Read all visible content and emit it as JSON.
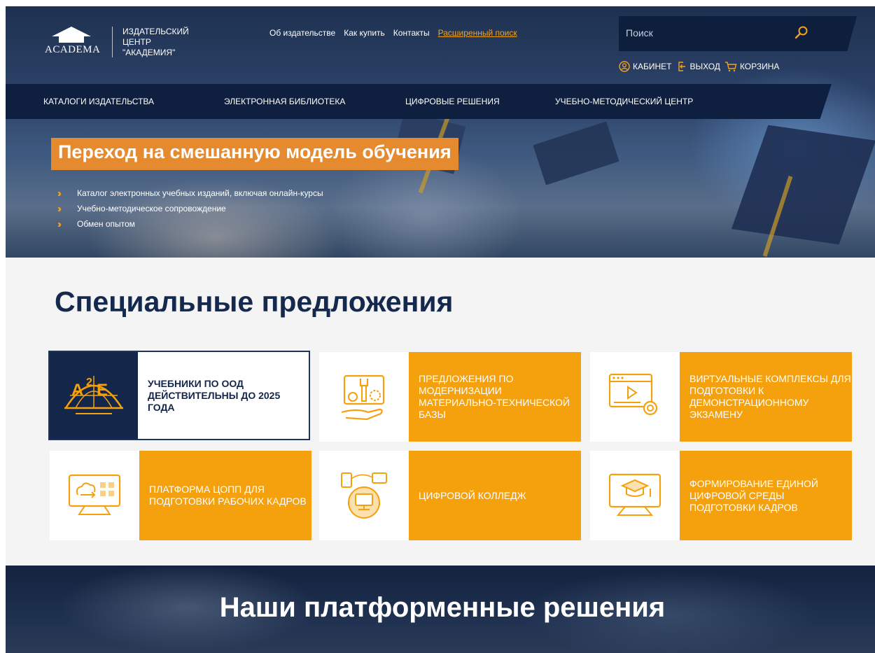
{
  "header": {
    "logo_text": "ACADEMA",
    "brand_line1": "ИЗДАТЕЛЬСКИЙ ЦЕНТР",
    "brand_line2": "\"АКАДЕМИЯ\"",
    "top_links": [
      "Об издательстве",
      "Как купить",
      "Контакты"
    ],
    "advanced_search": "Расширенный поиск",
    "search_placeholder": "Поиск",
    "cabinet": "КАБИНЕТ",
    "logout": "ВЫХОД",
    "cart": "КОРЗИНА"
  },
  "mainnav": [
    "КАТАЛОГИ ИЗДАТЕЛЬСТВА",
    "ЭЛЕКТРОННАЯ БИБЛИОТЕКА",
    "ЦИФРОВЫЕ РЕШЕНИЯ",
    "УЧЕБНО-МЕТОДИЧЕСКИЙ ЦЕНТР"
  ],
  "banner": {
    "title": "Переход на смешанную модель обучения",
    "bullets": [
      "Каталог электронных учебных изданий, включая онлайн-курсы",
      "Учебно-методическое сопровождение",
      "Обмен опытом"
    ]
  },
  "offers": {
    "title": "Специальные предложения",
    "cards": [
      {
        "label": "УЧЕБНИКИ ПО ООД ДЕЙСТВИТЕЛЬНЫ ДО 2025 ГОДА",
        "icon": "a2e-globe-icon"
      },
      {
        "label": "ПРЕДЛОЖЕНИЯ ПО МОДЕРНИЗАЦИИ МАТЕРИАЛЬНО-ТЕХНИЧЕСКОЙ БАЗЫ",
        "icon": "tools-hand-icon"
      },
      {
        "label": "ВИРТУАЛЬНЫЕ КОМПЛЕКСЫ ДЛЯ ПОДГОТОВКИ К ДЕМОНСТРАЦИОННОМУ ЭКЗАМЕНУ",
        "icon": "video-gear-icon"
      },
      {
        "label": "ПЛАТФОРМА ЦОПП ДЛЯ ПОДГОТОВКИ РАБОЧИХ КАДРОВ",
        "icon": "cloud-monitor-icon"
      },
      {
        "label": "ЦИФРОВОЙ КОЛЛЕДЖ",
        "icon": "devices-icon"
      },
      {
        "label": "ФОРМИРОВАНИЕ ЕДИНОЙ ЦИФРОВОЙ СРЕДЫ ПОДГОТОВКИ КАДРОВ",
        "icon": "graduation-monitor-icon"
      }
    ]
  },
  "platform": {
    "title": "Наши платформенные решения"
  },
  "colors": {
    "accent_orange": "#f5a10e",
    "banner_orange": "#e58a2e",
    "navy": "#0f1f3f"
  }
}
